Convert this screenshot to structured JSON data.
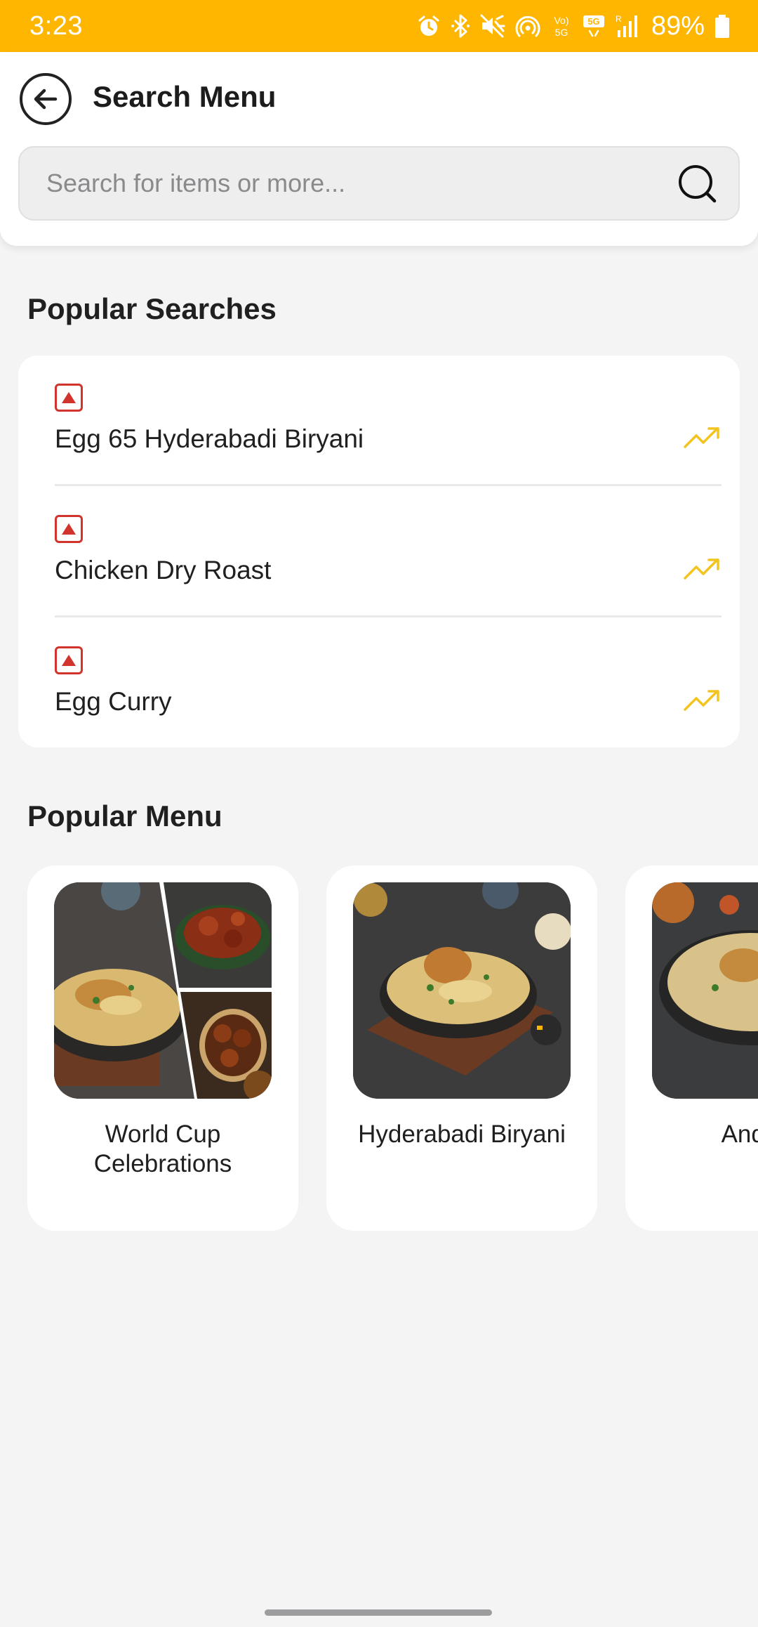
{
  "status_bar": {
    "time": "3:23",
    "battery": "89%",
    "icons": [
      "alarm-icon",
      "bluetooth-icon",
      "mute-icon",
      "hotspot-icon",
      "volte-icon",
      "5g-icon",
      "signal-icon",
      "battery-icon"
    ],
    "volte_text": "Vo) 5G",
    "net_text": "5G",
    "roaming_text": "R"
  },
  "header": {
    "title": "Search Menu",
    "back_icon": "back-arrow-icon"
  },
  "search": {
    "placeholder": "Search for items or more...",
    "value": "",
    "icon": "search-icon"
  },
  "popular_searches": {
    "title": "Popular Searches",
    "items": [
      {
        "label": "Egg 65 Hyderabadi Biryani",
        "marker": "non-veg-icon",
        "trend": "trending-up-icon"
      },
      {
        "label": "Chicken Dry Roast",
        "marker": "non-veg-icon",
        "trend": "trending-up-icon"
      },
      {
        "label": "Egg Curry",
        "marker": "non-veg-icon",
        "trend": "trending-up-icon"
      }
    ]
  },
  "popular_menu": {
    "title": "Popular Menu",
    "items": [
      {
        "label": "World Cup Celebrations"
      },
      {
        "label": "Hyderabadi Biryani"
      },
      {
        "label": "Andhra"
      }
    ]
  },
  "colors": {
    "status_bar": "#ffb600",
    "non_veg": "#d0342c",
    "trend": "#f2c420",
    "background": "#f4f4f5"
  }
}
